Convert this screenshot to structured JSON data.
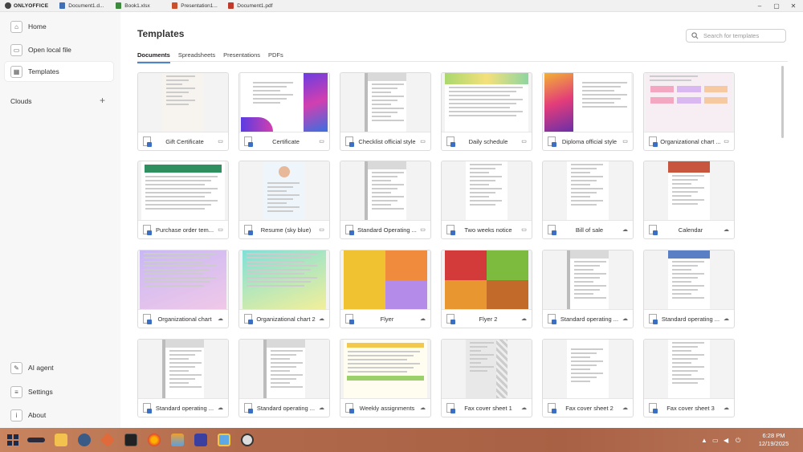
{
  "window": {
    "app_name": "ONLYOFFICE",
    "tabs": [
      {
        "label": "Document1.d...",
        "color": "#3f6fb5"
      },
      {
        "label": "Book1.xlsx",
        "color": "#3c8a3c"
      },
      {
        "label": "Presentation1...",
        "color": "#c8502d"
      },
      {
        "label": "Document1.pdf",
        "color": "#c0392b"
      }
    ],
    "controls": {
      "minimize": "–",
      "maximize": "▢",
      "close": "✕"
    }
  },
  "sidebar": {
    "items": [
      {
        "label": "Home",
        "icon": "home-icon",
        "glyph": "⌂"
      },
      {
        "label": "Open local file",
        "icon": "folder-icon",
        "glyph": "▭"
      },
      {
        "label": "Templates",
        "icon": "templates-icon",
        "glyph": "▦",
        "active": true
      }
    ],
    "clouds_label": "Clouds",
    "add_label": "+",
    "bottom": [
      {
        "label": "AI agent",
        "icon": "ai-agent-icon",
        "glyph": "✎"
      },
      {
        "label": "Settings",
        "icon": "settings-icon",
        "glyph": "≡"
      },
      {
        "label": "About",
        "icon": "info-icon",
        "glyph": "i"
      }
    ]
  },
  "main": {
    "title": "Templates",
    "search_placeholder": "Search for templates",
    "tabs": [
      {
        "label": "Documents",
        "active": true
      },
      {
        "label": "Spreadsheets"
      },
      {
        "label": "Presentations"
      },
      {
        "label": "PDFs"
      }
    ],
    "templates": [
      {
        "name": "Gift Certificate",
        "status": "local",
        "thumb": "gift"
      },
      {
        "name": "Certificate",
        "status": "local",
        "thumb": "cert"
      },
      {
        "name": "Checklist official style",
        "status": "local",
        "thumb": "form"
      },
      {
        "name": "Daily schedule",
        "status": "local",
        "thumb": "schedule"
      },
      {
        "name": "Diploma official style",
        "status": "local",
        "thumb": "diploma"
      },
      {
        "name": "Organizational chart ...",
        "status": "local",
        "thumb": "orgpink"
      },
      {
        "name": "Purchase order tem...",
        "status": "local",
        "thumb": "green"
      },
      {
        "name": "Resume (sky blue)",
        "status": "local",
        "thumb": "resume"
      },
      {
        "name": "Standard Operating ...",
        "status": "local",
        "thumb": "form"
      },
      {
        "name": "Two weeks notice",
        "status": "local",
        "thumb": "letter"
      },
      {
        "name": "Bill of sale",
        "status": "cloud",
        "thumb": "letter"
      },
      {
        "name": "Calendar",
        "status": "cloud",
        "thumb": "calendar"
      },
      {
        "name": "Organizational chart",
        "status": "cloud",
        "thumb": "orgpurple"
      },
      {
        "name": "Organizational chart 2",
        "status": "cloud",
        "thumb": "orgteal"
      },
      {
        "name": "Flyer",
        "status": "cloud",
        "thumb": "flyer"
      },
      {
        "name": "Flyer 2",
        "status": "cloud",
        "thumb": "flyer2"
      },
      {
        "name": "Standard operating ...",
        "status": "cloud",
        "thumb": "form"
      },
      {
        "name": "Standard operating ...",
        "status": "cloud",
        "thumb": "bluehead"
      },
      {
        "name": "Standard operating ...",
        "status": "cloud",
        "thumb": "form"
      },
      {
        "name": "Standard operating ...",
        "status": "cloud",
        "thumb": "form"
      },
      {
        "name": "Weekly assignments",
        "status": "cloud",
        "thumb": "weekly"
      },
      {
        "name": "Fax cover sheet 1",
        "status": "cloud",
        "thumb": "fax1"
      },
      {
        "name": "Fax cover sheet 2",
        "status": "cloud",
        "thumb": "fax2"
      },
      {
        "name": "Fax cover sheet 3",
        "status": "cloud",
        "thumb": "letter"
      }
    ]
  },
  "taskbar": {
    "time": "6:28 PM",
    "date": "12/19/2025"
  }
}
